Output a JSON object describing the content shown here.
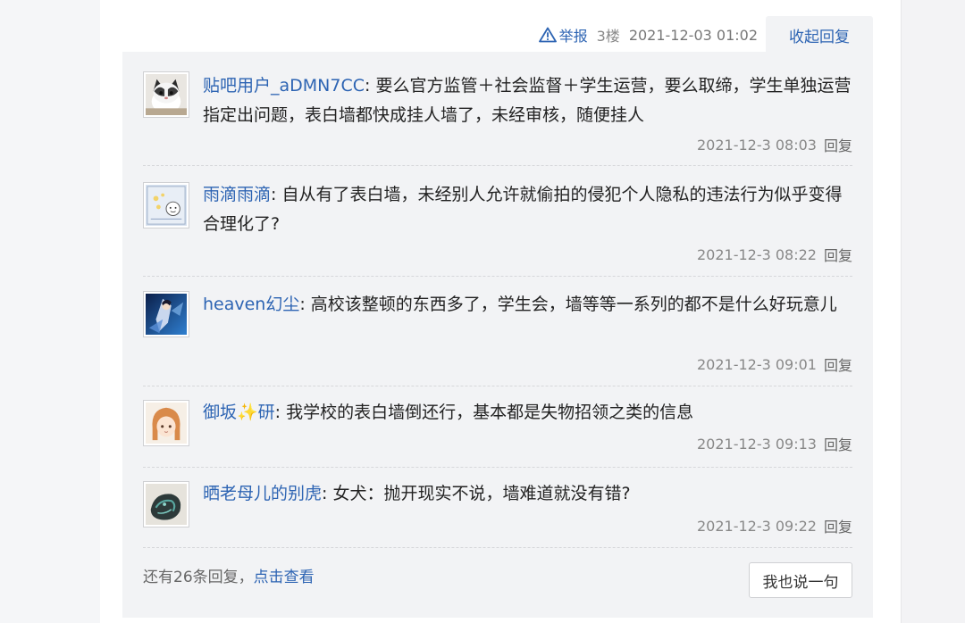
{
  "post": {
    "report_label": "举报",
    "floor": "3楼",
    "time": "2021-12-03 01:02",
    "collapse_label": "收起回复"
  },
  "replies": [
    {
      "user": "贴吧用户_aDMN7CC",
      "text": ": 要么官方监管＋社会监督＋学生运营，要么取缔，学生单独运营指定出问题，表白墙都快成挂人墙了，未经审核，随便挂人",
      "time": "2021-12-3 08:03",
      "reply_label": "回复",
      "avatar": "cat-avatar"
    },
    {
      "user": "雨滴雨滴",
      "text": ": 自从有了表白墙，未经别人允许就偷拍的侵犯个人隐私的违法行为似乎变得合理化了?",
      "time": "2021-12-3 08:22",
      "reply_label": "回复",
      "avatar": "doodle-avatar"
    },
    {
      "user": "heaven幻尘",
      "text": ": 高校该整顿的东西多了，学生会，墙等等一系列的都不是什么好玩意儿",
      "time": "2021-12-3 09:01",
      "reply_label": "回复",
      "avatar": "anime-blue-avatar"
    },
    {
      "user": "御坂✨研",
      "text": ": 我学校的表白墙倒还行，基本都是失物招领之类的信息",
      "time": "2021-12-3 09:13",
      "reply_label": "回复",
      "avatar": "anime-girl-avatar"
    },
    {
      "user": "晒老母儿的别虎",
      "text": ": 女犬：抛开现实不说，墙难道就没有错?",
      "time": "2021-12-3 09:22",
      "reply_label": "回复",
      "avatar": "dark-object-avatar"
    }
  ],
  "footer": {
    "more_text": "还有26条回复，",
    "view_link": "点击查看",
    "say_button": "我也说一句"
  }
}
